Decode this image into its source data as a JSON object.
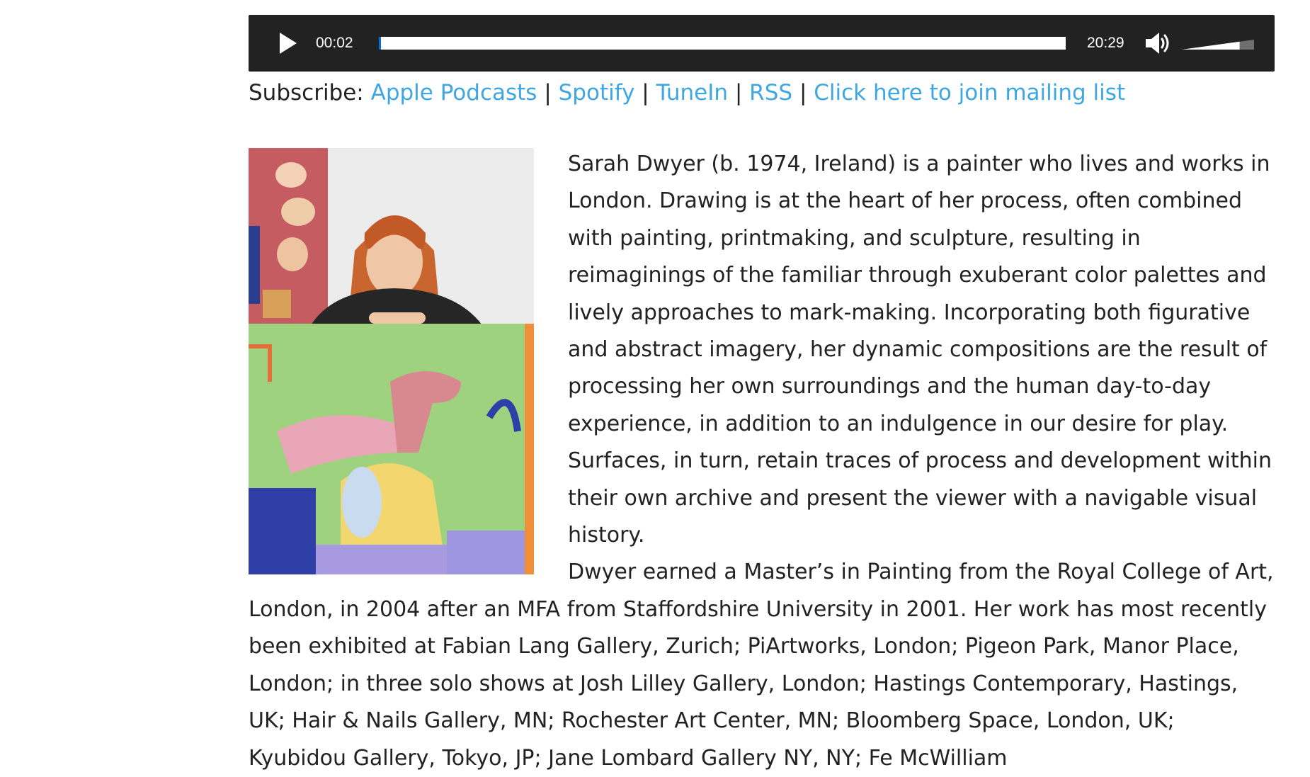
{
  "player": {
    "current_time": "00:02",
    "total_time": "20:29",
    "progress": 0.0016,
    "volume_level": 0.8,
    "play_icon": "play-icon",
    "volume_icon": "speaker-icon"
  },
  "subscribe": {
    "label": "Subscribe:",
    "separator": "|",
    "links": [
      "Apple Podcasts",
      "Spotify",
      "TuneIn",
      "RSS",
      "Click here to join mailing list"
    ]
  },
  "article": {
    "paragraphs": [
      "Sarah Dwyer (b. 1974, Ireland) is a painter who lives and works in London. Drawing is at the heart of her process, often combined with painting, printmaking, and sculpture, resulting in reimaginings of the familiar through exuberant color palettes and lively approaches to mark-making. Incorporating both figurative and abstract imagery, her dynamic compositions are the result of processing her own surroundings and the human day-to-day experience, in addition to an indulgence in our desire for play. Surfaces, in turn, retain traces of process and development within their own archive and present the viewer with a navigable visual history.",
      "Dwyer earned a Master’s in Painting from the Royal College of Art, London, in 2004 after an MFA from Staffordshire University in 2001. Her work has most recently been exhibited at Fabian Lang Gallery, Zurich; PiArtworks, London; Pigeon Park, Manor Place, London; in three solo shows at Josh Lilley Gallery, London; Hastings Contemporary, Hastings, UK; Hair & Nails Gallery, MN; Rochester Art Center, MN; Bloomberg Space, London, UK; Kyubidou Gallery, Tokyo, JP; Jane Lombard Gallery NY, NY; Fe McWilliam"
    ]
  },
  "colors": {
    "player_bg": "#222222",
    "link": "#3ea7e3",
    "text": "#222222",
    "progress": "#0a6ed1"
  }
}
